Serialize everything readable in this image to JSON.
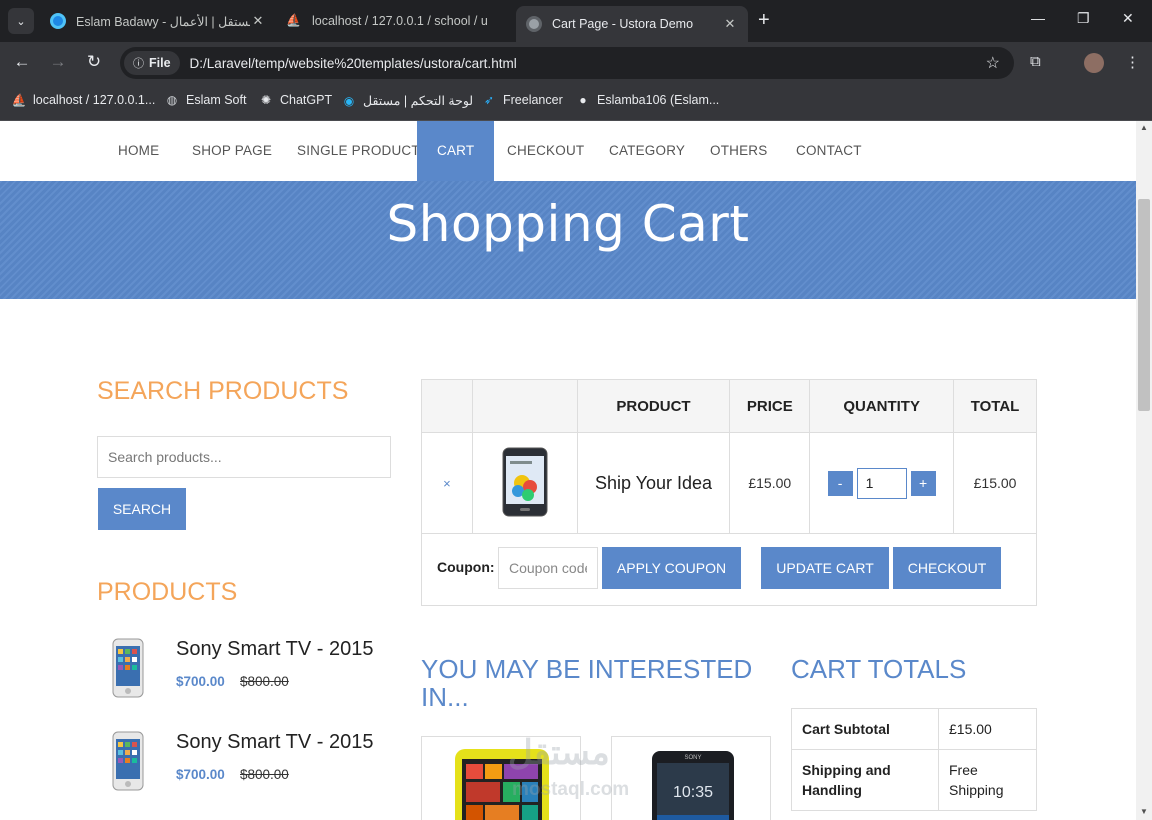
{
  "browser": {
    "tabs": [
      {
        "title": "Eslam Badawy - مستقل | الأعمال",
        "active": false
      },
      {
        "title": "localhost / 127.0.0.1 / school / u",
        "active": false
      },
      {
        "title": "Cart Page - Ustora Demo",
        "active": true
      }
    ],
    "file_chip": "File",
    "url": "D:/Laravel/temp/website%20templates/ustora/cart.html",
    "bookmarks": [
      {
        "label": "localhost / 127.0.0.1...",
        "icon": "phpmyadmin-icon"
      },
      {
        "label": "Eslam Soft",
        "icon": "globe-icon"
      },
      {
        "label": "ChatGPT",
        "icon": "openai-icon"
      },
      {
        "label": "لوحة التحكم | مستقل",
        "icon": "mostaql-icon"
      },
      {
        "label": "Freelancer",
        "icon": "freelancer-icon"
      },
      {
        "label": "Eslamba106 (Eslam...",
        "icon": "github-icon"
      }
    ]
  },
  "menu": {
    "items": [
      "Home",
      "Shop page",
      "Single product",
      "Cart",
      "Checkout",
      "Category",
      "Others",
      "Contact"
    ],
    "active": "Cart"
  },
  "banner": {
    "title": "Shopping Cart"
  },
  "sidebar": {
    "search_title": "Search Products",
    "search_placeholder": "Search products...",
    "search_button": "Search",
    "products_title": "Products",
    "products": [
      {
        "name": "Sony Smart TV - 2015",
        "price": "$700.00",
        "old_price": "$800.00"
      },
      {
        "name": "Sony Smart TV - 2015",
        "price": "$700.00",
        "old_price": "$800.00"
      }
    ]
  },
  "cart": {
    "headers": [
      "",
      "",
      "Product",
      "Price",
      "Quantity",
      "Total"
    ],
    "rows": [
      {
        "remove": "×",
        "name": "Ship Your Idea",
        "price": "£15.00",
        "quantity": "1",
        "total": "£15.00",
        "minus": "-",
        "plus": "+"
      }
    ],
    "coupon_label": "Coupon:",
    "coupon_placeholder": "Coupon code",
    "apply_coupon": "Apply Coupon",
    "update_cart": "Update Cart",
    "checkout": "Checkout"
  },
  "cross_sells": {
    "title": "You may be interested in..."
  },
  "totals": {
    "title": "Cart Totals",
    "rows": [
      {
        "label": "Cart Subtotal",
        "value": "£15.00"
      },
      {
        "label": "Shipping and Handling",
        "value": "Free Shipping"
      }
    ]
  },
  "watermark": {
    "arabic": "مستقل",
    "latin": "mostaql.com"
  },
  "colors": {
    "accent": "#5a88ca",
    "sidebar_heading": "#f4a55a"
  }
}
